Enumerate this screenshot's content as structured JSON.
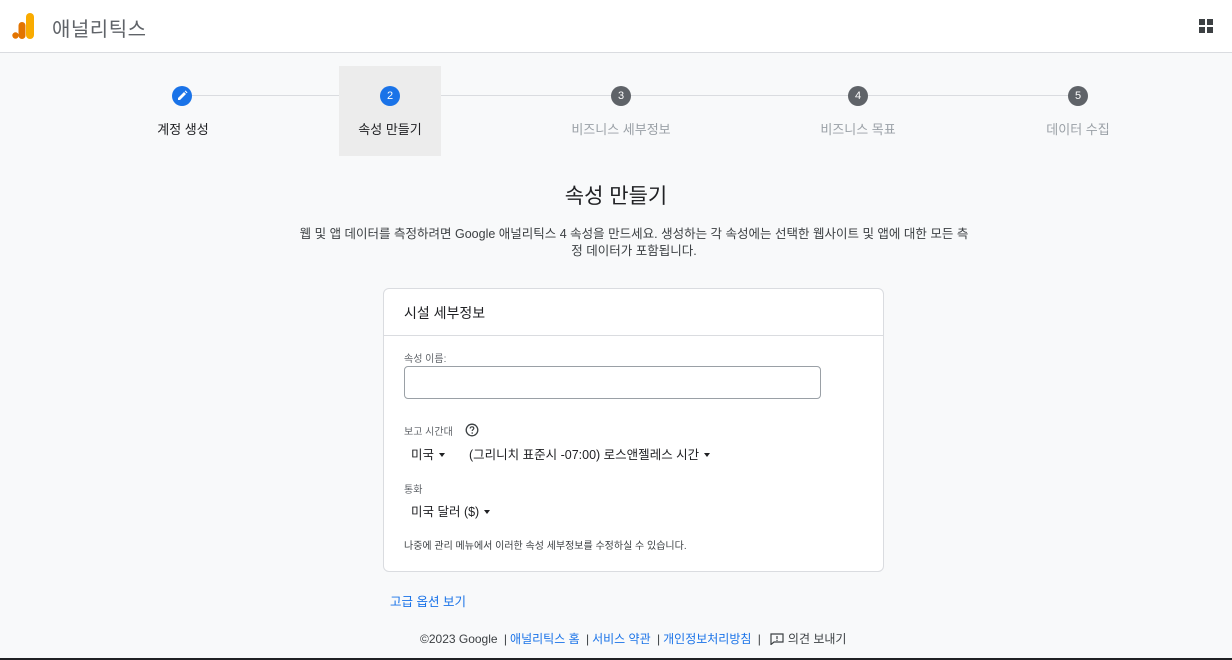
{
  "header": {
    "app_title": "애널리틱스",
    "logo_icon": "google-analytics-logo",
    "apps_icon": "grid-apps-icon",
    "brand_colors": {
      "orange": "#f9ab00",
      "dark_orange": "#e37400"
    }
  },
  "stepper": {
    "steps": [
      {
        "number": "",
        "label": "계정 생성",
        "state": "completed",
        "icon": "pencil-icon"
      },
      {
        "number": "2",
        "label": "속성 만들기",
        "state": "active"
      },
      {
        "number": "3",
        "label": "비즈니스 세부정보",
        "state": "pending"
      },
      {
        "number": "4",
        "label": "비즈니스 목표",
        "state": "pending"
      },
      {
        "number": "5",
        "label": "데이터 수집",
        "state": "pending"
      }
    ]
  },
  "main": {
    "title": "속성 만들기",
    "description": "웹 및 앱 데이터를 측정하려면 Google 애널리틱스 4 속성을 만드세요. 생성하는 각 속성에는 선택한 웹사이트 및 앱에 대한 모든 측정 데이터가 포함됩니다."
  },
  "card": {
    "title": "시설 세부정보",
    "property_name_label": "속성 이름:",
    "property_name_value": "",
    "timezone_label": "보고 시간대",
    "timezone_country": "미국",
    "timezone_value": "(그리니치 표준시 -07:00) 로스앤젤레스 시간",
    "currency_label": "통화",
    "currency_value": "미국 달러 ($)",
    "note": "나중에 관리 메뉴에서 이러한 속성 세부정보를 수정하실 수 있습니다."
  },
  "advanced_link": "고급 옵션 보기",
  "footer": {
    "copyright": "©2023 Google",
    "links": [
      "애널리틱스 홈",
      "서비스 약관",
      "개인정보처리방침"
    ],
    "feedback": "의견 보내기",
    "separator": "|"
  },
  "colors": {
    "accent": "#1a73e8",
    "step_pending": "#5f6368",
    "active_step_bg": "#ececec"
  }
}
